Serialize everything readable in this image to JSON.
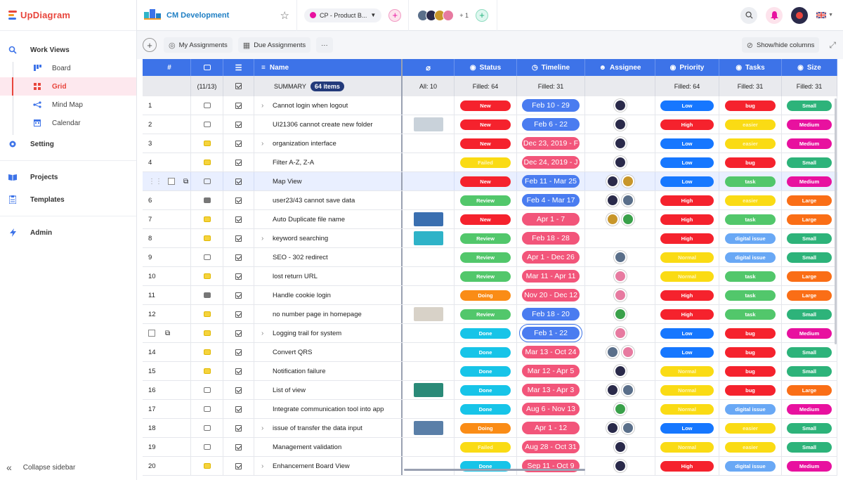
{
  "app": {
    "name": "UpDiagram",
    "brand_color": "#e8453c"
  },
  "sidebar": {
    "work_views_label": "Work Views",
    "views": [
      {
        "label": "Board",
        "icon": "board-icon"
      },
      {
        "label": "Grid",
        "icon": "grid-icon",
        "active": true
      },
      {
        "label": "Mind Map",
        "icon": "mindmap-icon"
      },
      {
        "label": "Calendar",
        "icon": "calendar-icon"
      }
    ],
    "setting_label": "Setting",
    "projects_label": "Projects",
    "templates_label": "Templates",
    "admin_label": "Admin",
    "collapse_label": "Collapse sidebar"
  },
  "topbar": {
    "workspace_title": "CM Development",
    "project_tab": "CP - Product B...",
    "members_more": "+ 1"
  },
  "toolbar": {
    "my_assignments": "My Assignments",
    "due_assignments": "Due Assignments",
    "more": "···",
    "show_hide": "Show/hide columns"
  },
  "grid": {
    "headers": {
      "num": "#",
      "name": "Name",
      "status": "Status",
      "timeline": "Timeline",
      "assignee": "Assignee",
      "priority": "Priority",
      "tasks": "Tasks",
      "size": "Size"
    },
    "summary": {
      "comments": "(11/13)",
      "label": "SUMMARY",
      "count": "64 items",
      "attachments": "All: 10",
      "status": "Filled: 64",
      "timeline": "Filled: 31",
      "priority": "Filled: 64",
      "tasks": "Filled: 31",
      "size": "Filled: 31"
    },
    "colors": {
      "New": "#f5222d",
      "Review": "#52c76b",
      "Doing": "#fa8c16",
      "Done": "#17c4e8",
      "Failed": "#fadb14",
      "Low": "#1677ff",
      "High": "#f5222d",
      "Normal": "#fadb14",
      "bug": "#f5222d",
      "easier": "#fadb14",
      "task": "#52c76b",
      "digital issue": "#69a8f5",
      "Small": "#2db37a",
      "Medium": "#e8119f",
      "Large": "#fa6e16",
      "tl_blue": "#4a7cf0",
      "tl_pink": "#f2557a"
    },
    "rows": [
      {
        "num": "1",
        "name": "Cannot login when logout",
        "expand": true,
        "comment": "empty",
        "thumb": "",
        "status": "New",
        "timeline": "Feb 10 - 29",
        "tl": "tl_blue",
        "assignees": [
          "#2a2a4a"
        ],
        "priority": "Low",
        "task": "bug",
        "size": "Small"
      },
      {
        "num": "2",
        "name": "UI21306 cannot create new folder",
        "expand": false,
        "comment": "empty",
        "thumb": "#c9d2da",
        "status": "New",
        "timeline": "Feb 6 - 22",
        "tl": "tl_blue",
        "assignees": [
          "#2a2a4a"
        ],
        "priority": "High",
        "task": "easier",
        "size": "Medium"
      },
      {
        "num": "3",
        "name": "organization interface",
        "expand": true,
        "comment": "yellow",
        "thumb": "",
        "status": "New",
        "timeline": "Dec 23, 2019 - F",
        "tl": "tl_pink",
        "assignees": [
          "#2a2a4a"
        ],
        "priority": "Low",
        "task": "easier",
        "size": "Medium"
      },
      {
        "num": "4",
        "name": "Filter A-Z, Z-A",
        "expand": false,
        "comment": "yellow",
        "thumb": "",
        "status": "Failed",
        "timeline": "Dec 24, 2019 - J",
        "tl": "tl_pink",
        "assignees": [
          "#2a2a4a"
        ],
        "priority": "Low",
        "task": "bug",
        "size": "Small"
      },
      {
        "num": "",
        "name": "Map View",
        "expand": false,
        "comment": "empty",
        "thumb": "",
        "status": "New",
        "timeline": "Feb 11 - Mar 25",
        "tl": "tl_blue",
        "assignees": [
          "#2a2a4a",
          "#c8962a"
        ],
        "priority": "Low",
        "task": "task",
        "size": "Medium",
        "selected": true
      },
      {
        "num": "6",
        "name": "user23/43 cannot save data",
        "expand": false,
        "comment": "gray",
        "thumb": "",
        "status": "Review",
        "timeline": "Feb 4 - Mar 17",
        "tl": "tl_blue",
        "assignees": [
          "#2a2a4a",
          "#5a6f8a"
        ],
        "priority": "High",
        "task": "easier",
        "size": "Large"
      },
      {
        "num": "7",
        "name": "Auto Duplicate file name",
        "expand": false,
        "comment": "yellow",
        "thumb": "#3a6fb0",
        "status": "New",
        "timeline": "Apr 1 - 7",
        "tl": "tl_pink",
        "assignees": [
          "#c8962a",
          "#3aa14a"
        ],
        "priority": "High",
        "task": "task",
        "size": "Large"
      },
      {
        "num": "8",
        "name": "keyword searching",
        "expand": true,
        "comment": "yellow",
        "thumb": "#2fb3c8",
        "status": "Review",
        "timeline": "Feb 18 - 28",
        "tl": "tl_pink",
        "assignees": [],
        "priority": "High",
        "task": "digital issue",
        "size": "Small"
      },
      {
        "num": "9",
        "name": "SEO - 302 redirect",
        "expand": false,
        "comment": "empty",
        "thumb": "",
        "status": "Review",
        "timeline": "Apr 1 - Dec 26",
        "tl": "tl_pink",
        "assignees": [
          "#5a6f8a"
        ],
        "priority": "Normal",
        "task": "digital issue",
        "size": "Small"
      },
      {
        "num": "10",
        "name": "lost return URL",
        "expand": false,
        "comment": "yellow",
        "thumb": "",
        "status": "Review",
        "timeline": "Mar 11 - Apr 11",
        "tl": "tl_pink",
        "assignees": [
          "#e77aa0"
        ],
        "priority": "Normal",
        "task": "task",
        "size": "Large"
      },
      {
        "num": "11",
        "name": "Handle cookie login",
        "expand": false,
        "comment": "gray",
        "thumb": "",
        "status": "Doing",
        "timeline": "Nov 20 - Dec 12",
        "tl": "tl_pink",
        "assignees": [
          "#e77aa0"
        ],
        "priority": "High",
        "task": "task",
        "size": "Large"
      },
      {
        "num": "12",
        "name": "no number page in homepage",
        "expand": false,
        "comment": "yellow",
        "thumb": "#d8d2c8",
        "status": "Review",
        "timeline": "Feb 18 - 20",
        "tl": "tl_blue",
        "assignees": [
          "#3aa14a"
        ],
        "priority": "High",
        "task": "task",
        "size": "Small"
      },
      {
        "num": "",
        "name": "Logging trail for system",
        "expand": true,
        "comment": "yellow",
        "thumb": "",
        "status": "Done",
        "timeline": "Feb 1 - 22",
        "tl": "tl_blue",
        "assignees": [
          "#e77aa0"
        ],
        "priority": "Low",
        "task": "bug",
        "size": "Medium",
        "hover": true
      },
      {
        "num": "14",
        "name": "Convert QRS",
        "expand": false,
        "comment": "yellow",
        "thumb": "",
        "status": "Done",
        "timeline": "Mar 13 - Oct 24",
        "tl": "tl_pink",
        "assignees": [
          "#5a6f8a",
          "#e77aa0"
        ],
        "priority": "Low",
        "task": "bug",
        "size": "Small"
      },
      {
        "num": "15",
        "name": "Notification failure",
        "expand": false,
        "comment": "yellow",
        "thumb": "",
        "status": "Done",
        "timeline": "Mar 12 - Apr 5",
        "tl": "tl_pink",
        "assignees": [
          "#2a2a4a"
        ],
        "priority": "Normal",
        "task": "bug",
        "size": "Small"
      },
      {
        "num": "16",
        "name": "List of view",
        "expand": false,
        "comment": "empty",
        "thumb": "#2a8a78",
        "status": "Done",
        "timeline": "Mar 13 - Apr 3",
        "tl": "tl_pink",
        "assignees": [
          "#2a2a4a",
          "#5a6f8a"
        ],
        "priority": "Normal",
        "task": "bug",
        "size": "Large"
      },
      {
        "num": "17",
        "name": "Integrate communication tool into app",
        "expand": false,
        "comment": "empty",
        "thumb": "",
        "status": "Done",
        "timeline": "Aug 6 - Nov 13",
        "tl": "tl_pink",
        "assignees": [
          "#3aa14a"
        ],
        "priority": "Normal",
        "task": "digital issue",
        "size": "Medium"
      },
      {
        "num": "18",
        "name": "issue of transfer the data input",
        "expand": true,
        "comment": "empty",
        "thumb": "#5a7fa8",
        "status": "Doing",
        "timeline": "Apr 1 - 12",
        "tl": "tl_pink",
        "assignees": [
          "#2a2a4a",
          "#5a6f8a"
        ],
        "priority": "Low",
        "task": "easier",
        "size": "Small"
      },
      {
        "num": "19",
        "name": "Management validation",
        "expand": false,
        "comment": "empty",
        "thumb": "",
        "status": "Failed",
        "timeline": "Aug 28 - Oct 31",
        "tl": "tl_pink",
        "assignees": [
          "#2a2a4a"
        ],
        "priority": "Normal",
        "task": "easier",
        "size": "Small"
      },
      {
        "num": "20",
        "name": "Enhancement Board View",
        "expand": true,
        "comment": "yellow",
        "thumb": "",
        "status": "Done",
        "timeline": "Sep 11 - Oct 9",
        "tl": "tl_pink",
        "assignees": [
          "#2a2a4a"
        ],
        "priority": "High",
        "task": "digital issue",
        "size": "Medium"
      }
    ]
  }
}
